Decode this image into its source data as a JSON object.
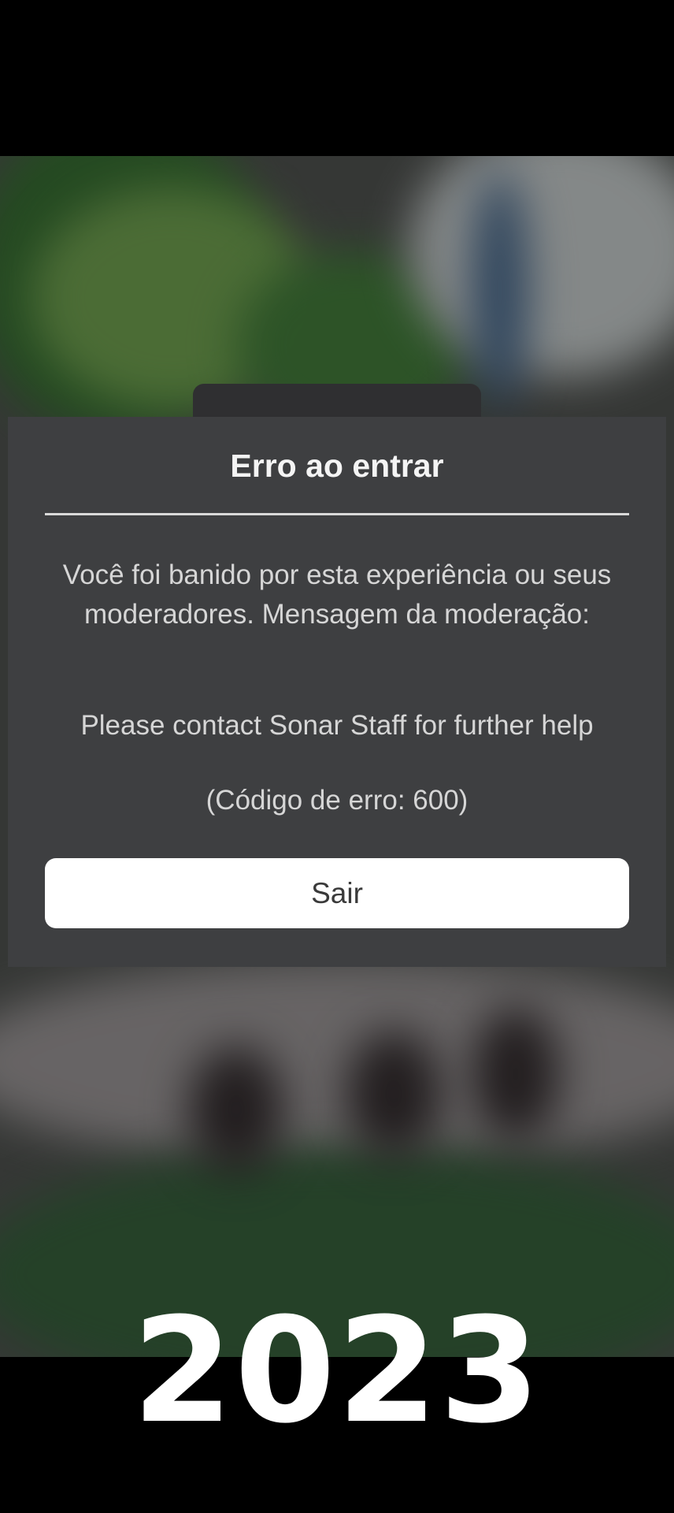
{
  "dialog": {
    "title": "Erro ao entrar",
    "message": "Você foi banido por esta experiência ou seus moderadores. Mensagem da moderação:",
    "moderation_message": "Please contact Sonar Staff for further help",
    "error_code_text": "(Código de erro: 600)",
    "exit_button_label": "Sair"
  },
  "caption": {
    "year": "2023"
  },
  "colors": {
    "dialog_background": "#3e3f41",
    "button_background": "#ffffff",
    "page_background": "#000000"
  }
}
